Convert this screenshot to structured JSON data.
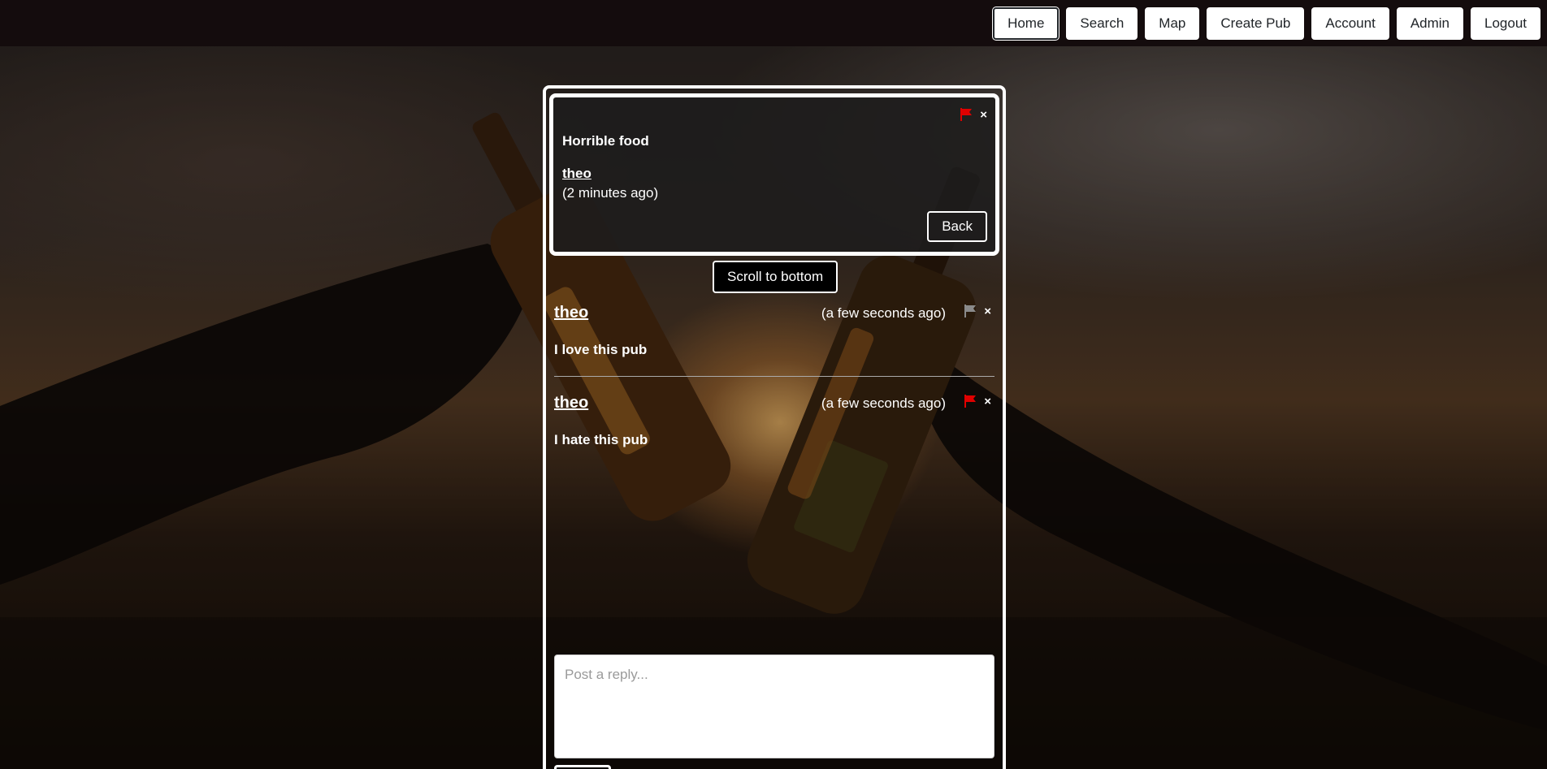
{
  "nav": {
    "items": [
      {
        "label": "Home",
        "active": true
      },
      {
        "label": "Search"
      },
      {
        "label": "Map"
      },
      {
        "label": "Create Pub"
      },
      {
        "label": "Account"
      },
      {
        "label": "Admin"
      },
      {
        "label": "Logout"
      }
    ]
  },
  "post": {
    "title": "Horrible food",
    "author": "theo",
    "time": "(2 minutes ago)",
    "flag_color": "#e00000",
    "flag_icon": "flag-icon",
    "close_icon": "close-icon",
    "close_glyph": "×",
    "back_label": "Back"
  },
  "scroll_to_bottom_label": "Scroll to bottom",
  "replies": [
    {
      "author": "theo",
      "time": "(a few seconds ago)",
      "body": "I love this pub",
      "flag_color": "#8a8a8a",
      "close_glyph": "×"
    },
    {
      "author": "theo",
      "time": "(a few seconds ago)",
      "body": "I hate this pub",
      "flag_color": "#e00000",
      "close_glyph": "×"
    }
  ],
  "reply_input": {
    "placeholder": "Post a reply..."
  }
}
